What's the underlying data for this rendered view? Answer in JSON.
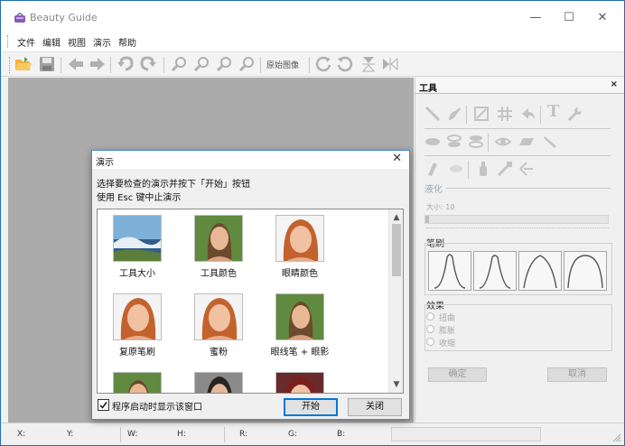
{
  "app": {
    "title": "Beauty Guide",
    "icon": "purse-icon"
  },
  "window_controls": {
    "minimize": "—",
    "maximize": "☐",
    "close": "✕"
  },
  "menu": {
    "items": [
      "文件",
      "编辑",
      "视图",
      "演示",
      "帮助"
    ]
  },
  "toolbar": {
    "buttons": [
      "open-folder",
      "save",
      "arrow-back",
      "arrow-forward",
      "undo",
      "redo",
      "zoom-in",
      "zoom-out",
      "zoom-fit",
      "zoom-actual"
    ],
    "original_image_label": "原始图像",
    "trailing_buttons": [
      "rotate-left",
      "rotate-right",
      "flip-vertical",
      "flip-horizontal"
    ]
  },
  "tools_panel": {
    "title": "工具",
    "close": "×",
    "liquify_label": "液化",
    "size_label": "大小: 10",
    "size_value": 10,
    "brush_label": "笔刷",
    "effects_label": "效果",
    "effects": [
      "扭曲",
      "膨胀",
      "收缩"
    ],
    "ok_label": "确定",
    "cancel_label": "取消"
  },
  "status_bar": {
    "labels": [
      "X:",
      "Y:",
      "W:",
      "H:",
      "R:",
      "G:",
      "B:"
    ]
  },
  "demo_dialog": {
    "title": "演示",
    "close": "✕",
    "instruction_1": "选择要检查的演示并按下「开始」按钮",
    "instruction_2": "使用 Esc 键中止演示",
    "items": [
      {
        "label": "工具大小"
      },
      {
        "label": "工具颜色"
      },
      {
        "label": "眼睛颜色"
      },
      {
        "label": "复原笔刷"
      },
      {
        "label": "蜜粉"
      },
      {
        "label": "眼线笔 + 眼影"
      },
      {
        "label": ""
      },
      {
        "label": ""
      },
      {
        "label": ""
      }
    ],
    "show_on_startup_label": "程序启动时显示该窗口",
    "show_on_startup_checked": true,
    "start_label": "开始",
    "close_label": "关闭"
  },
  "colors": {
    "accent": "#0078d7",
    "canvas": "#ababab",
    "icon_orange": "#f4a41c"
  }
}
